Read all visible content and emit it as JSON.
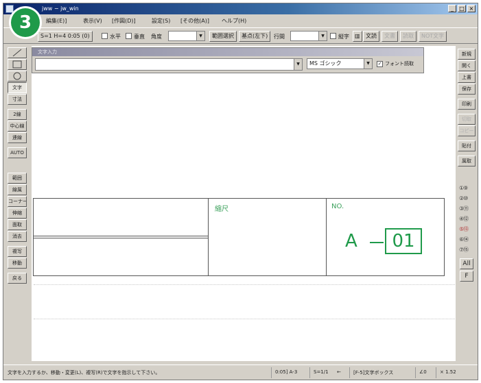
{
  "step_badge": "3",
  "window": {
    "title": "jww − jw_win",
    "controls": {
      "minimize": "_",
      "restore": "□",
      "close": "×"
    }
  },
  "menubar": {
    "items": [
      "編集(E)]",
      "表示(V)",
      "[作図(D)]",
      "設定(S)",
      "[その他(A)]",
      "ヘルプ(H)"
    ]
  },
  "toolbar": {
    "scale_label": "S=1 H=4 0:05 (0)",
    "horizontal_label": "水平",
    "vertical_label": "垂直",
    "angle_label": "角度",
    "range_button": "範囲選択",
    "base_point_button": "基点(左下)",
    "line_spacing_label": "行間",
    "vertical_text_label": "縦字",
    "buttons": [
      "文読",
      "文書",
      "読取",
      "NOT文字"
    ]
  },
  "left_tools": [
    "文字",
    "寸法",
    "2線",
    "中心線",
    "連線",
    "AUTO",
    "範囲",
    "線属",
    "コーナー",
    "伸縮",
    "面取",
    "消去",
    "複写",
    "移動",
    "戻る"
  ],
  "right_tools": {
    "buttons": [
      "新規",
      "開く",
      "上書",
      "保存",
      "印刷",
      "切取",
      "コピー",
      "貼付",
      "属取"
    ],
    "layer_pairs": [
      "①⑨",
      "②⑩",
      "③⑪",
      "④⑫",
      "⑤⑬",
      "⑥⑭",
      "⑦⑮"
    ],
    "all_button": "All",
    "f_button": "F"
  },
  "text_panel": {
    "title": "文字入力",
    "font_value": "MS ゴシック",
    "font_read_label": "フォント読取"
  },
  "title_block": {
    "scale_label": "縮尺",
    "number_label": "NO.",
    "drawing_prefix": "A",
    "drawing_number": "01"
  },
  "statusbar": {
    "message": "文字を入力するか、移動・変更(L)、複写(R)で文字を指示して下さい。",
    "layer": "0:05] A-3",
    "scale": "S=1/1",
    "arrow": "←",
    "layer_name": "[F-5]文字ボックス",
    "angle": "∠0",
    "zoom": "× 1.52"
  }
}
